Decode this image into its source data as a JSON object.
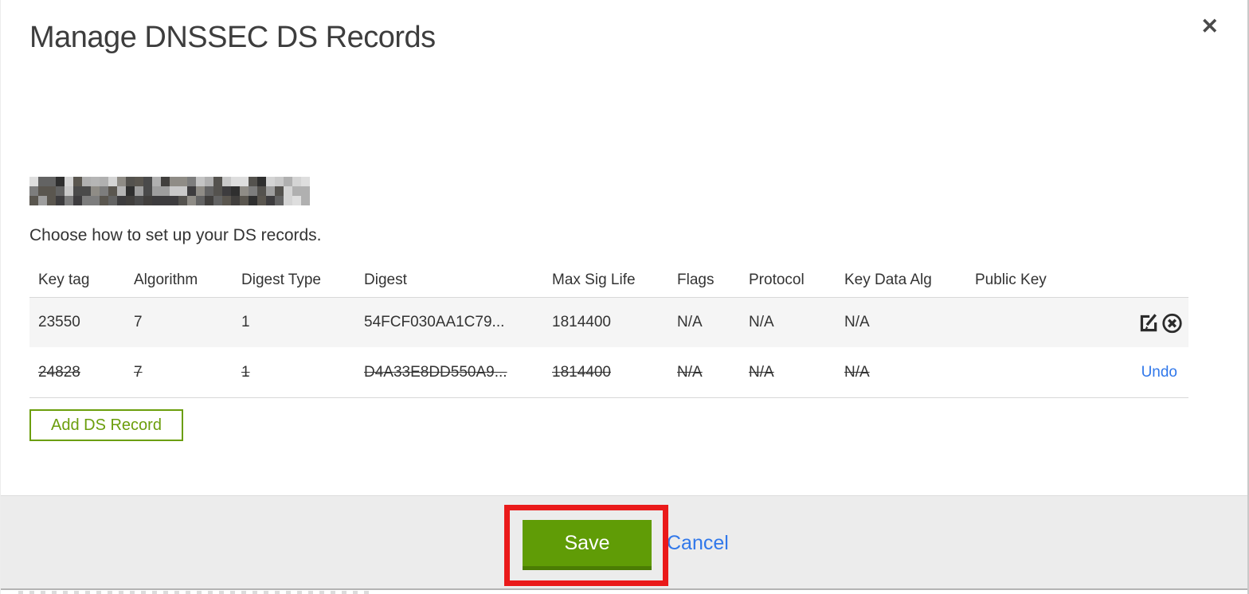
{
  "modal": {
    "title": "Manage DNSSEC DS Records",
    "close_label": "✕",
    "domain_redacted": true,
    "instruction": "Choose how to set up your DS records."
  },
  "table": {
    "headers": [
      "Key tag",
      "Algorithm",
      "Digest Type",
      "Digest",
      "Max Sig Life",
      "Flags",
      "Protocol",
      "Key Data Alg",
      "Public Key"
    ],
    "rows": [
      {
        "cells": [
          "23550",
          "7",
          "1",
          "54FCF030AA1C79...",
          "1814400",
          "N/A",
          "N/A",
          "N/A",
          ""
        ],
        "deleted": false,
        "actions": [
          "edit",
          "delete"
        ]
      },
      {
        "cells": [
          "24828",
          "7",
          "1",
          "D4A33E8DD550A9...",
          "1814400",
          "N/A",
          "N/A",
          "N/A",
          ""
        ],
        "deleted": true,
        "undo_label": "Undo"
      }
    ]
  },
  "buttons": {
    "add_ds_record": "Add DS Record",
    "save": "Save",
    "cancel": "Cancel"
  },
  "annotation": {
    "type": "red-box",
    "target": "save-button",
    "color": "#ea1a1a"
  },
  "colors": {
    "button_green": "#609c06",
    "button_green_dark": "#4b7d04",
    "outline_green": "#6b9e0c",
    "link_blue": "#3178ea",
    "row_highlight": "#f5f5f5",
    "annotation_red": "#ea1a1a"
  }
}
